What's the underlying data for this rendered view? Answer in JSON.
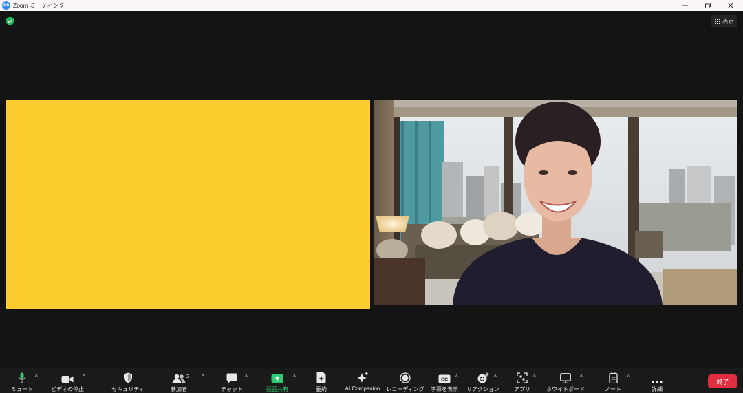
{
  "window": {
    "title": "Zoom ミーティング",
    "logo_text": "zm",
    "minimize_icon": "minimize-icon",
    "restore_icon": "restore-icon",
    "close_icon": "close-icon"
  },
  "meeting": {
    "encryption_icon": "shield-check-icon",
    "view_label": "表示",
    "tiles": [
      {
        "type": "video-off",
        "color": "#fdcd30"
      },
      {
        "type": "camera",
        "description": ""
      }
    ]
  },
  "toolbar": {
    "items": [
      {
        "label": "ミュート",
        "icon": "microphone-icon",
        "caret": true
      },
      {
        "label": "ビデオの停止",
        "icon": "video-camera-icon",
        "caret": true
      },
      {
        "label": "セキュリティ",
        "icon": "shield-icon",
        "caret": false
      },
      {
        "label": "参加者",
        "icon": "participants-icon",
        "caret": true,
        "count": "2"
      },
      {
        "label": "チャット",
        "icon": "chat-icon",
        "caret": true
      },
      {
        "label": "画面共有",
        "icon": "share-screen-icon",
        "caret": true,
        "accent": "#2ecc71"
      },
      {
        "label": "要約",
        "icon": "summary-icon",
        "caret": false
      },
      {
        "label": "AI Companion",
        "icon": "ai-sparkle-icon",
        "caret": false
      },
      {
        "label": "レコーディング",
        "icon": "record-icon",
        "caret": false
      },
      {
        "label": "字幕を表示",
        "icon": "captions-icon",
        "caret": true,
        "icon_text": "CC"
      },
      {
        "label": "リアクション",
        "icon": "reaction-icon",
        "caret": true
      },
      {
        "label": "アプリ",
        "icon": "apps-icon",
        "caret": true
      },
      {
        "label": "ホワイトボード",
        "icon": "whiteboard-icon",
        "caret": true
      },
      {
        "label": "ノート",
        "icon": "notes-icon",
        "caret": true
      },
      {
        "label": "詳細",
        "icon": "more-icon",
        "caret": false
      }
    ],
    "end_label": "終了",
    "end_color": "#e02d3f"
  }
}
